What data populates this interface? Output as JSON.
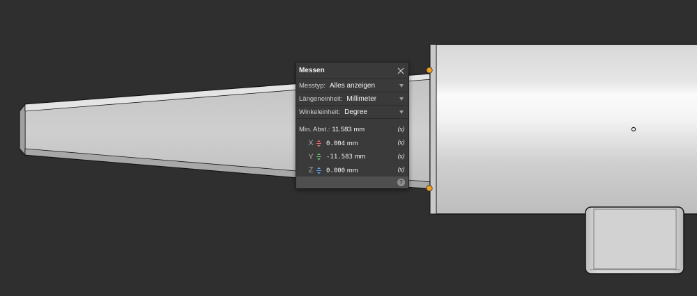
{
  "panel": {
    "title": "Messen",
    "rows": {
      "messtyp": {
        "label": "Messtyp:",
        "value": "Alles anzeigen"
      },
      "laenge": {
        "label": "Längeneinheit:",
        "value": "Millimeter"
      },
      "winkel": {
        "label": "Winkeleinheit:",
        "value": "Degree"
      }
    },
    "min": {
      "label": "Min. Abst.:",
      "value": "11.583",
      "unit": "mm"
    },
    "x": {
      "axis": "X",
      "value": "0.004",
      "unit": "mm"
    },
    "y": {
      "axis": "Y",
      "value": "-11.583",
      "unit": "mm"
    },
    "z": {
      "axis": "Z",
      "value": "0.000",
      "unit": "mm"
    },
    "copy_label": "(x)",
    "help_label": "?"
  },
  "colors": {
    "background": "#2f2f2f",
    "panel": "#3a3a3a",
    "marker": "#f0a020",
    "axis_x": "#e06b6b",
    "axis_y": "#6bc06b",
    "axis_z": "#5f9ee6"
  }
}
